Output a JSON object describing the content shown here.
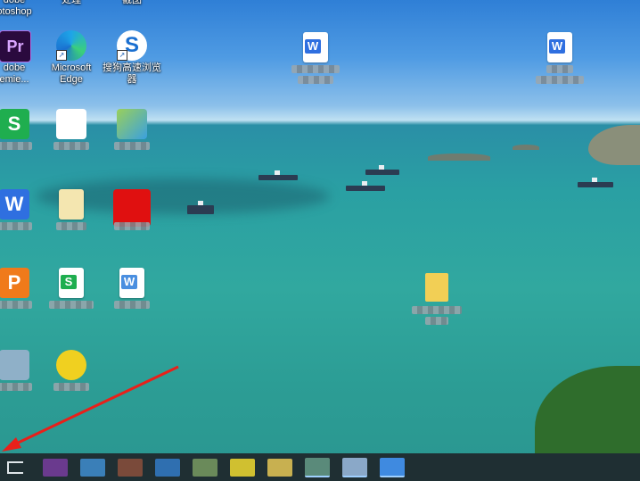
{
  "desktop": {
    "icons": [
      {
        "name": "adobe-photoshop",
        "label": "dobe\notoshop"
      },
      {
        "name": "adobe-premiere",
        "label": "dobe\nemie...",
        "glyph": "Pr"
      },
      {
        "name": "microsoft-edge",
        "label": "Microsoft\nEdge"
      },
      {
        "name": "sogou-browser",
        "label": "搜狗高速浏览\n器"
      }
    ],
    "top_labels": [
      "处理",
      "截图"
    ]
  },
  "colors": {
    "taskbar": "#1f2f33",
    "premiere": "#2a0a3e",
    "wps_sheet": "#1fae4f",
    "wps_doc": "#2f6fe0",
    "wps_ppt": "#f07a1a",
    "arrow": "#e8201a"
  },
  "taskbar": {
    "task_view_icon": "task-view-icon"
  }
}
